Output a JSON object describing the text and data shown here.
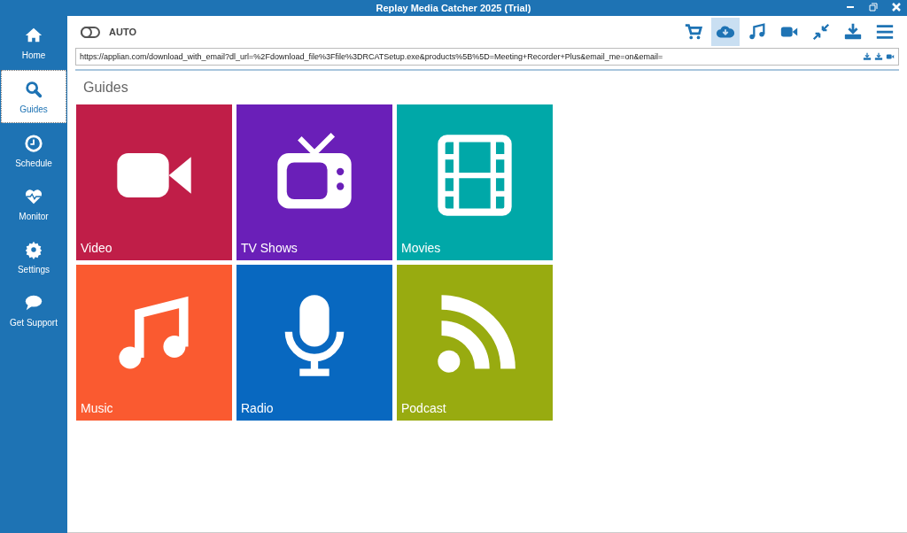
{
  "window": {
    "title": "Replay Media Catcher 2025 (Trial)"
  },
  "sidebar": {
    "items": [
      {
        "label": "Home",
        "kind": "home",
        "selected": false
      },
      {
        "label": "Guides",
        "kind": "search",
        "selected": true
      },
      {
        "label": "Schedule",
        "kind": "clock",
        "selected": false
      },
      {
        "label": "Monitor",
        "kind": "heart",
        "selected": false
      },
      {
        "label": "Settings",
        "kind": "gear",
        "selected": false
      },
      {
        "label": "Get Support",
        "kind": "chat",
        "selected": false
      }
    ]
  },
  "toolbar": {
    "auto_toggle": {
      "label": "AUTO",
      "on": false
    },
    "buttons": [
      {
        "kind": "cart",
        "selected": false
      },
      {
        "kind": "cloud",
        "selected": true
      },
      {
        "kind": "music",
        "selected": false
      },
      {
        "kind": "video",
        "selected": false
      },
      {
        "kind": "compress",
        "selected": false
      },
      {
        "kind": "download",
        "selected": false
      },
      {
        "kind": "menu",
        "selected": false
      }
    ]
  },
  "url_field": {
    "value": "https://applian.com/download_with_email?dl_url=%2Fdownload_file%3Ffile%3DRCATSetup.exe&products%5B%5D=Meeting+Recorder+Plus&email_me=on&email="
  },
  "heading": "Guides",
  "tiles": [
    {
      "label": "Video",
      "kind": "video",
      "color": "#c01e48"
    },
    {
      "label": "TV Shows",
      "kind": "tv",
      "color": "#6a1fb8"
    },
    {
      "label": "Movies",
      "kind": "film",
      "color": "#00a8a8"
    },
    {
      "label": "Music",
      "kind": "music",
      "color": "#fa5a30"
    },
    {
      "label": "Radio",
      "kind": "mic",
      "color": "#0868c0"
    },
    {
      "label": "Podcast",
      "kind": "rss",
      "color": "#98ab10"
    }
  ]
}
